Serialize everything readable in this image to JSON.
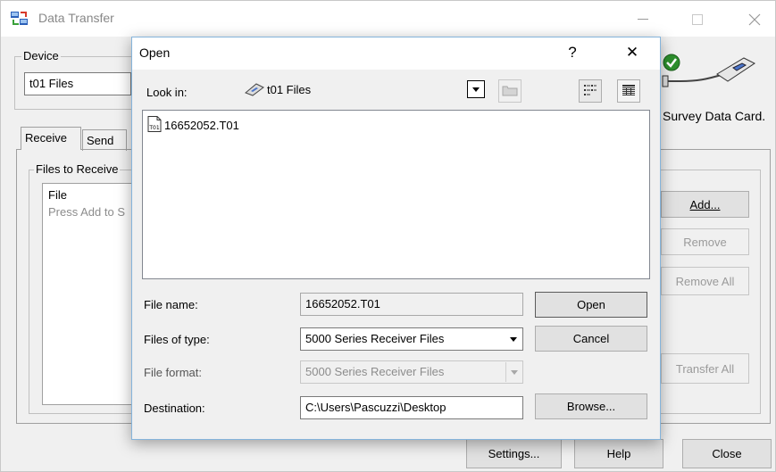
{
  "main_window": {
    "title": "Data Transfer",
    "device_group_label": "Device",
    "device_value": "t01 Files",
    "card_text": "Survey Data Card.",
    "tabs": [
      "Receive",
      "Send"
    ],
    "files_group_label": "Files to Receive",
    "list_header": "File",
    "list_hint": "Press Add to S",
    "buttons": {
      "add": "Add...",
      "remove": "Remove",
      "remove_all": "Remove All",
      "transfer_all": "Transfer All",
      "settings": "Settings...",
      "help": "Help",
      "close": "Close"
    }
  },
  "open_dialog": {
    "title": "Open",
    "help_glyph": "?",
    "close_glyph": "✕",
    "look_in_label": "Look in:",
    "look_in_value": "t01 Files",
    "files": [
      "16652052.T01"
    ],
    "file_icon_text": "T01",
    "file_name_label": "File name:",
    "file_name_value": "16652052.T01",
    "files_of_type_label": "Files of type:",
    "files_of_type_value": "5000 Series Receiver Files",
    "file_format_label": "File format:",
    "file_format_value": "5000 Series Receiver Files",
    "destination_label": "Destination:",
    "destination_value": "C:\\Users\\Pascuzzi\\Desktop",
    "buttons": {
      "open": "Open",
      "cancel": "Cancel",
      "browse": "Browse..."
    }
  }
}
